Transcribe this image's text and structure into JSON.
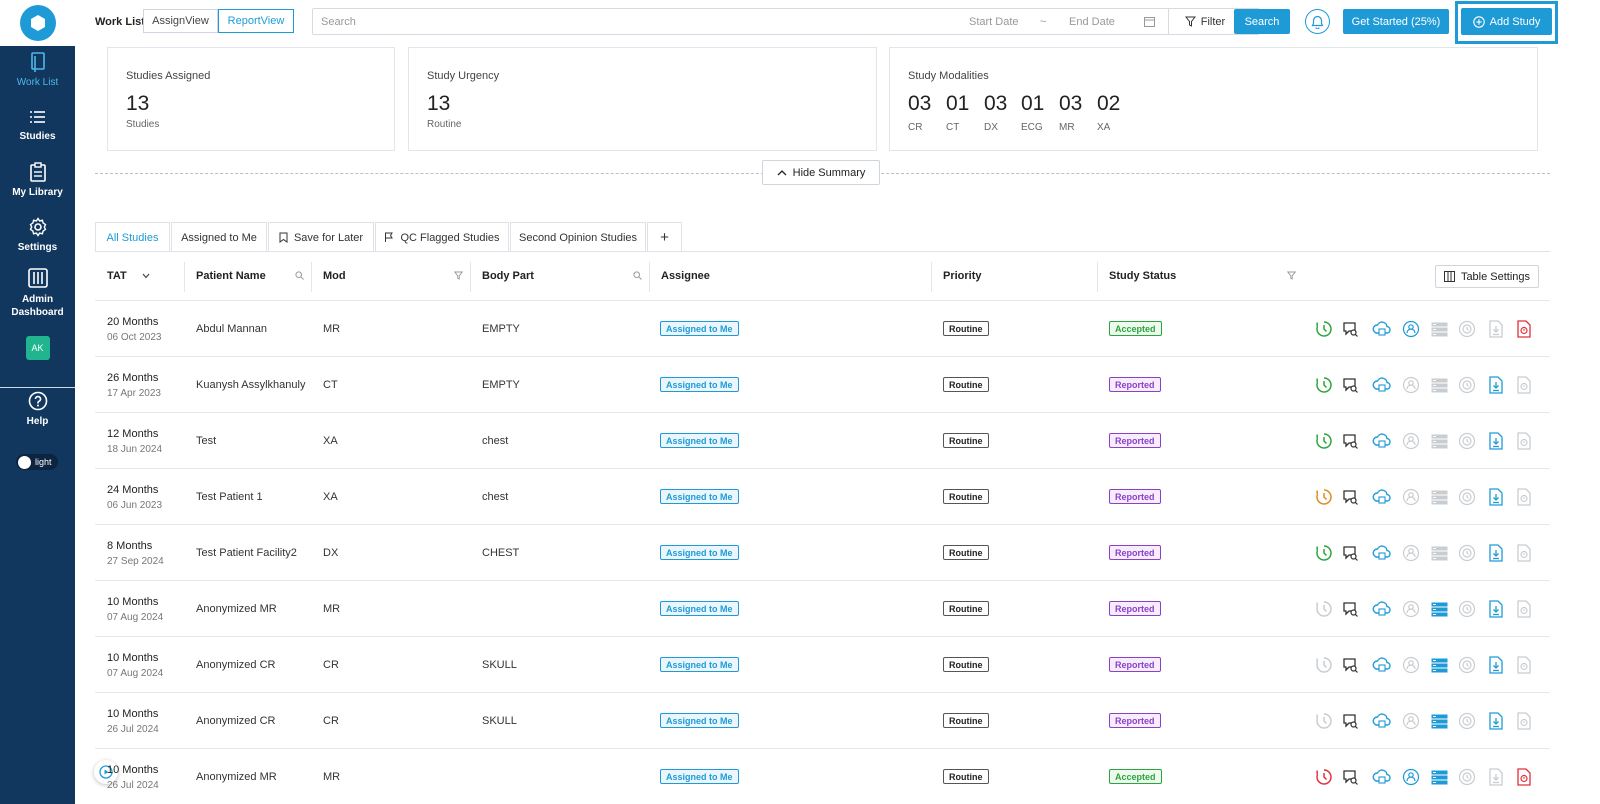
{
  "header": {
    "worklist_label": "Work List",
    "assign_view": "AssignView",
    "report_view": "ReportView",
    "search_placeholder": "Search",
    "start_date": "Start Date",
    "date_sep": "~",
    "end_date": "End Date",
    "filter": "Filter",
    "search_btn": "Search",
    "get_started": "Get Started (25%)",
    "add_study": "Add Study"
  },
  "sidebar": {
    "items": [
      {
        "label": "Work List",
        "icon": "document-icon"
      },
      {
        "label": "Studies",
        "icon": "list-icon"
      },
      {
        "label": "My Library",
        "icon": "library-icon"
      },
      {
        "label": "Settings",
        "icon": "gear-icon"
      },
      {
        "label": "Admin\nDashboard",
        "icon": "sliders-icon"
      }
    ],
    "avatar": "AK",
    "help": "Help",
    "theme": "light"
  },
  "summary": {
    "assigned": {
      "title": "Studies Assigned",
      "count": "13",
      "sub": "Studies"
    },
    "urgency": {
      "title": "Study Urgency",
      "count": "13",
      "sub": "Routine"
    },
    "modalities": {
      "title": "Study Modalities",
      "items": [
        {
          "count": "03",
          "label": "CR"
        },
        {
          "count": "01",
          "label": "CT"
        },
        {
          "count": "03",
          "label": "DX"
        },
        {
          "count": "01",
          "label": "ECG"
        },
        {
          "count": "03",
          "label": "MR"
        },
        {
          "count": "02",
          "label": "XA"
        }
      ]
    },
    "hide_label": "Hide Summary"
  },
  "tabs": [
    "All Studies",
    "Assigned to Me",
    "Save for Later",
    "QC Flagged Studies",
    "Second Opinion Studies",
    "+"
  ],
  "table": {
    "headers": {
      "tat": "TAT",
      "patient": "Patient Name",
      "mod": "Mod",
      "body": "Body Part",
      "assignee": "Assignee",
      "priority": "Priority",
      "status": "Study Status",
      "settings": "Table Settings"
    },
    "rows": [
      {
        "tat": "20 Months",
        "date": "06 Oct 2023",
        "name": "Abdul Mannan",
        "mod": "MR",
        "body": "EMPTY",
        "assignee": "Assigned to Me",
        "priority": "Routine",
        "status": "Accepted",
        "timer": "#2aa63a",
        "user_active": true,
        "server_active": false,
        "download_active": false,
        "report_red": true
      },
      {
        "tat": "26 Months",
        "date": "17 Apr 2023",
        "name": "Kuanysh Assylkhanuly",
        "mod": "CT",
        "body": "EMPTY",
        "assignee": "Assigned to Me",
        "priority": "Routine",
        "status": "Reported",
        "timer": "#2aa63a",
        "user_active": false,
        "server_active": false,
        "download_active": true,
        "report_red": false
      },
      {
        "tat": "12 Months",
        "date": "18 Jun 2024",
        "name": "Test",
        "mod": "XA",
        "body": "chest",
        "assignee": "Assigned to Me",
        "priority": "Routine",
        "status": "Reported",
        "timer": "#2aa63a",
        "user_active": false,
        "server_active": false,
        "download_active": true,
        "report_red": false
      },
      {
        "tat": "24 Months",
        "date": "06 Jun 2023",
        "name": "Test Patient 1",
        "mod": "XA",
        "body": "chest",
        "assignee": "Assigned to Me",
        "priority": "Routine",
        "status": "Reported",
        "timer": "#e08a1e",
        "user_active": false,
        "server_active": false,
        "download_active": true,
        "report_red": false
      },
      {
        "tat": "8 Months",
        "date": "27 Sep 2024",
        "name": "Test Patient Facility2",
        "mod": "DX",
        "body": "CHEST",
        "assignee": "Assigned to Me",
        "priority": "Routine",
        "status": "Reported",
        "timer": "#2aa63a",
        "user_active": false,
        "server_active": false,
        "download_active": true,
        "report_red": false
      },
      {
        "tat": "10 Months",
        "date": "07 Aug 2024",
        "name": "Anonymized MR",
        "mod": "MR",
        "body": "",
        "assignee": "Assigned to Me",
        "priority": "Routine",
        "status": "Reported",
        "timer": "#c8cdd2",
        "user_active": false,
        "server_active": true,
        "download_active": true,
        "report_red": false
      },
      {
        "tat": "10 Months",
        "date": "07 Aug 2024",
        "name": "Anonymized CR",
        "mod": "CR",
        "body": "SKULL",
        "assignee": "Assigned to Me",
        "priority": "Routine",
        "status": "Reported",
        "timer": "#c8cdd2",
        "user_active": false,
        "server_active": true,
        "download_active": true,
        "report_red": false
      },
      {
        "tat": "10 Months",
        "date": "26 Jul 2024",
        "name": "Anonymized CR",
        "mod": "CR",
        "body": "SKULL",
        "assignee": "Assigned to Me",
        "priority": "Routine",
        "status": "Reported",
        "timer": "#c8cdd2",
        "user_active": false,
        "server_active": true,
        "download_active": true,
        "report_red": false
      },
      {
        "tat": "10 Months",
        "date": "26 Jul 2024",
        "name": "Anonymized MR",
        "mod": "MR",
        "body": "",
        "assignee": "Assigned to Me",
        "priority": "Routine",
        "status": "Accepted",
        "timer": "#e0303a",
        "user_active": true,
        "server_active": true,
        "download_active": false,
        "report_red": true
      }
    ]
  },
  "colors": {
    "accent": "#1e9bd7",
    "sidebar": "#12375e",
    "accepted": "#2aa63a",
    "reported": "#8e3fc9",
    "danger": "#e0303a"
  }
}
